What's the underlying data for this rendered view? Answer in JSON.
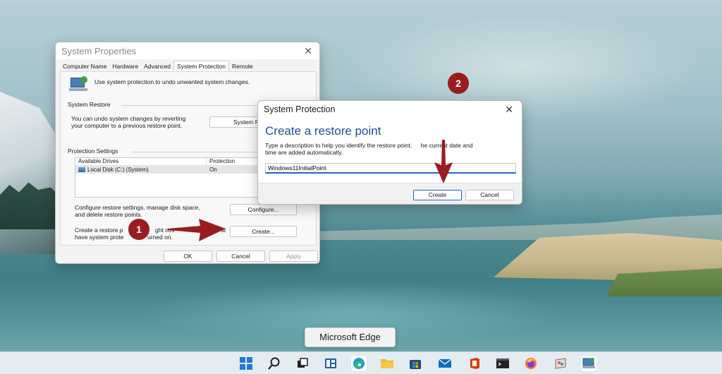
{
  "system_properties": {
    "title": "System Properties",
    "tabs": [
      "Computer Name",
      "Hardware",
      "Advanced",
      "System Protection",
      "Remote"
    ],
    "active_tab": "System Protection",
    "intro": "Use system protection to undo unwanted system changes.",
    "system_restore": {
      "label": "System Restore",
      "text_line1": "You can undo system changes by reverting",
      "text_line2": "your computer to a previous restore point.",
      "button": "System R"
    },
    "protection_settings": {
      "label": "Protection Settings",
      "col_drives": "Available Drives",
      "col_protection": "Protection",
      "drive_name": "Local Disk (C:) (System)",
      "drive_protection": "On"
    },
    "configure": {
      "text_line1": "Configure restore settings, manage disk space,",
      "text_line2": "and delete restore points.",
      "button": "Configure..."
    },
    "create": {
      "text_line1a": "Create a restore p",
      "text_line1b": "ght nov",
      "text_line1c": "at",
      "text_line2a": "have system prote",
      "text_line2b": "urned on.",
      "button": "Create..."
    },
    "ok": "OK",
    "cancel": "Cancel",
    "apply": "Apply"
  },
  "system_protection": {
    "title": "System Protection",
    "heading": "Create a restore point",
    "desc_line1a": "Type a description to help you identify the restore point.",
    "desc_line1b": "he current date and",
    "desc_line2": "time are added automatically.",
    "input_value": "Windows11InitialPoint",
    "create": "Create",
    "cancel": "Cancel"
  },
  "annotations": {
    "step1": "1",
    "step2": "2",
    "color": "#9b1c1f"
  },
  "tooltip": "Microsoft Edge",
  "taskbar": {
    "icons": [
      "windows-start-icon",
      "search-icon",
      "task-view-icon",
      "widgets-icon",
      "edge-icon",
      "file-explorer-icon",
      "microsoft-store-icon",
      "mail-icon",
      "office-icon",
      "terminal-icon",
      "firefox-icon",
      "paint-icon",
      "system-properties-icon"
    ],
    "active": "edge-icon"
  }
}
